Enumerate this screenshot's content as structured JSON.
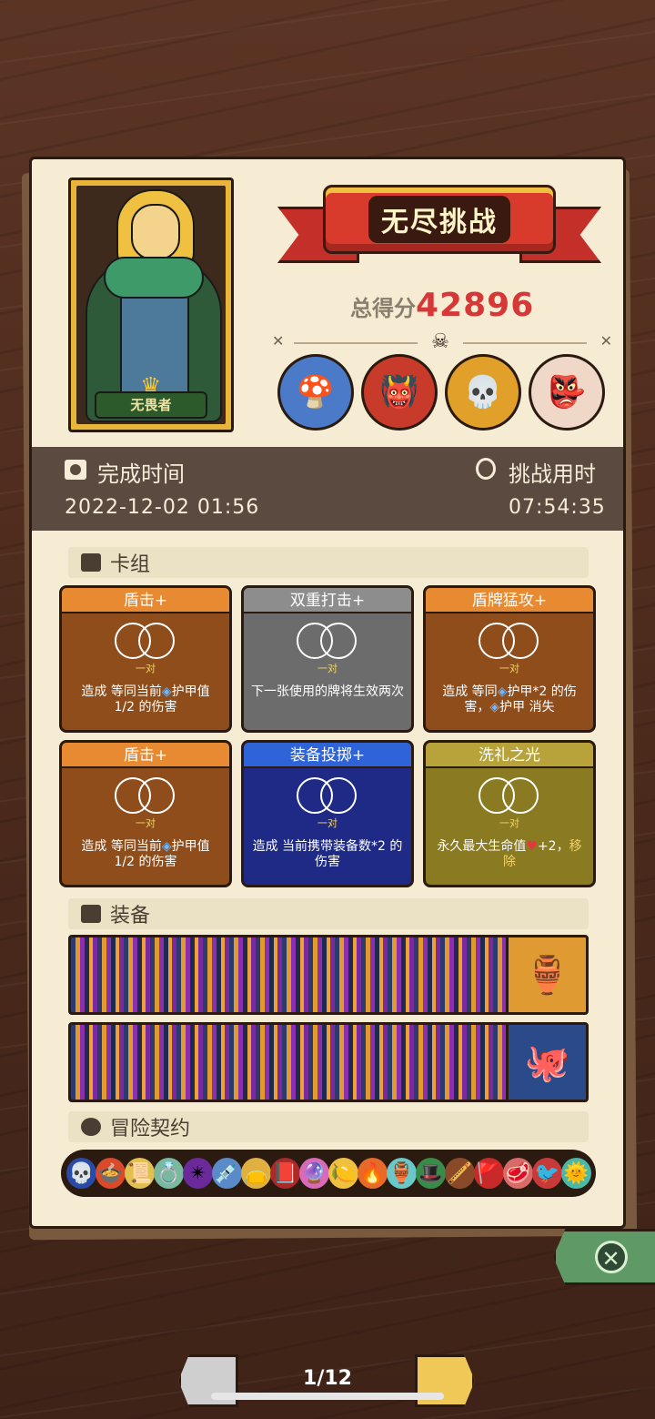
{
  "hero": {
    "name": "无畏者"
  },
  "mode": {
    "title": "无尽挑战"
  },
  "score": {
    "label": "总得分",
    "value": "42896"
  },
  "bosses": [
    {
      "icon": "mushroom-wizard-icon",
      "glyph": "🍄",
      "color": "#4a7ac8"
    },
    {
      "icon": "cube-monster-icon",
      "glyph": "👹",
      "color": "#c83a2a"
    },
    {
      "icon": "skull-demon-icon",
      "glyph": "💀",
      "color": "#e0a02a"
    },
    {
      "icon": "flame-mask-icon",
      "glyph": "👺",
      "color": "#f0d8c8"
    }
  ],
  "time": {
    "finish_label": "完成时间",
    "finish_value": "2022-12-02 01:56",
    "duration_label": "挑战用时",
    "duration_value": "07:54:35"
  },
  "deck": {
    "header": "卡组",
    "cards": [
      {
        "title": "盾击+",
        "pair": "一对",
        "desc_a": "造成 等同当前",
        "desc_b": "护甲值 1/2 的伤害",
        "theme": "orange"
      },
      {
        "title": "双重打击+",
        "pair": "一对",
        "desc": "下一张使用的牌将生效两次",
        "theme": "gray"
      },
      {
        "title": "盾牌猛攻+",
        "pair": "一对",
        "desc_a": "造成 等同",
        "desc_b": "护甲*2 的伤害，",
        "desc_c": "护甲 消失",
        "theme": "orange"
      },
      {
        "title": "盾击+",
        "pair": "一对",
        "desc_a": "造成 等同当前",
        "desc_b": "护甲值 1/2 的伤害",
        "theme": "orange"
      },
      {
        "title": "装备投掷+",
        "pair": "一对",
        "desc": "造成 当前携带装备数*2 的伤害",
        "theme": "blue"
      },
      {
        "title": "洗礼之光",
        "pair": "一对",
        "desc_a": "永久最大生命值",
        "desc_b": "+2，",
        "desc_c": "移除",
        "theme": "olive"
      }
    ]
  },
  "equipment": {
    "header": "装备",
    "items": [
      {
        "icon": "teal-vase-icon",
        "glyph": "🏺",
        "slot_color": "#e09a32"
      },
      {
        "icon": "blue-octopus-icon",
        "glyph": "🐙",
        "slot_color": "#2a4a8a"
      }
    ]
  },
  "contracts": {
    "header": "冒险契约",
    "items": [
      {
        "icon": "blue-flame-skull-icon",
        "glyph": "💀",
        "bg": "#2a4aa8"
      },
      {
        "icon": "heart-pot-icon",
        "glyph": "🍲",
        "bg": "#d84a2a"
      },
      {
        "icon": "scroll-icon",
        "glyph": "📜",
        "bg": "#e0c050"
      },
      {
        "icon": "ring-icon",
        "glyph": "💍",
        "bg": "#7ab8a0"
      },
      {
        "icon": "purple-star-icon",
        "glyph": "✴",
        "bg": "#6a2a9a"
      },
      {
        "icon": "syringe-icon",
        "glyph": "💉",
        "bg": "#5a8ac8"
      },
      {
        "icon": "yellow-pouch-icon",
        "glyph": "👝",
        "bg": "#e0b040"
      },
      {
        "icon": "red-heart-book-icon",
        "glyph": "📕",
        "bg": "#a82a2a"
      },
      {
        "icon": "pink-orb-icon",
        "glyph": "🔮",
        "bg": "#d86ab8"
      },
      {
        "icon": "lemon-icon",
        "glyph": "🍋",
        "bg": "#f0c040"
      },
      {
        "icon": "fire-icon",
        "glyph": "🔥",
        "bg": "#e86a2a"
      },
      {
        "icon": "cyan-vase-icon",
        "glyph": "🏺",
        "bg": "#6ac8c8"
      },
      {
        "icon": "green-hat-icon",
        "glyph": "🎩",
        "bg": "#3a8a4a"
      },
      {
        "icon": "pipe-icon",
        "glyph": "🪈",
        "bg": "#8a4a2a"
      },
      {
        "icon": "red-banner-icon",
        "glyph": "🚩",
        "bg": "#c82a2a"
      },
      {
        "icon": "meat-icon",
        "glyph": "🥩",
        "bg": "#d86a6a"
      },
      {
        "icon": "red-bird-icon",
        "glyph": "🐦",
        "bg": "#c83a3a"
      },
      {
        "icon": "sun-face-icon",
        "glyph": "🌞",
        "bg": "#4ab8a8"
      }
    ]
  },
  "pagination": {
    "label": "1/12"
  }
}
